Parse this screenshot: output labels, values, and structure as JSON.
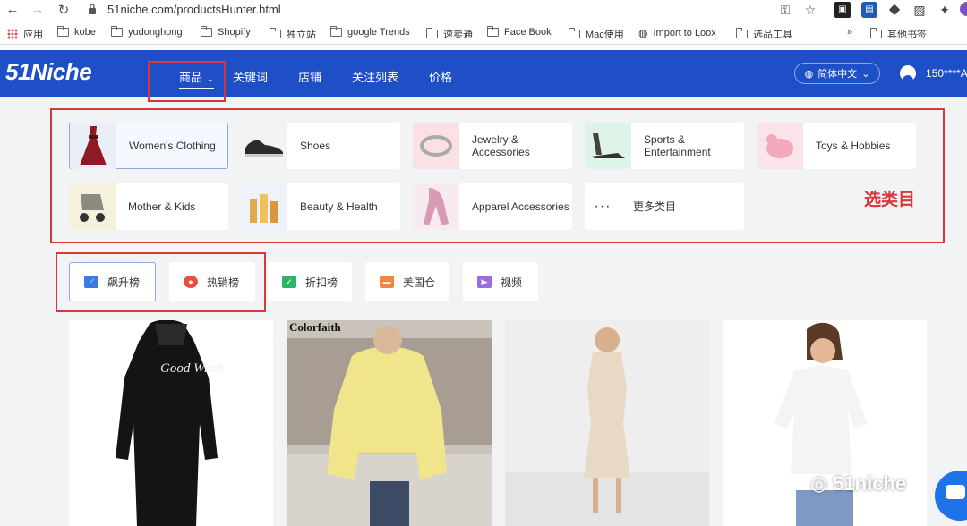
{
  "browser": {
    "url": "51niche.com/productsHunter.html",
    "bookmarks": [
      {
        "label": "应用",
        "icon": "apps-grid-icon"
      },
      {
        "label": "kobe",
        "icon": "folder-icon"
      },
      {
        "label": "yudonghong",
        "icon": "folder-icon"
      },
      {
        "label": "Shopify",
        "icon": "folder-icon"
      },
      {
        "label": "独立站",
        "icon": "folder-icon"
      },
      {
        "label": "google Trends",
        "icon": "folder-icon"
      },
      {
        "label": "速卖通",
        "icon": "folder-icon"
      },
      {
        "label": "Face Book",
        "icon": "folder-icon"
      },
      {
        "label": "Mac使用",
        "icon": "folder-icon"
      },
      {
        "label": "Import to Loox",
        "icon": "globe-icon"
      },
      {
        "label": "选品工具",
        "icon": "folder-icon"
      }
    ],
    "bookmarks_overflow": "»",
    "other_bookmarks": "其他书签"
  },
  "site": {
    "logo": "51Niche",
    "nav": [
      {
        "label": "商品"
      },
      {
        "label": "关键词"
      },
      {
        "label": "店铺"
      },
      {
        "label": "关注列表"
      },
      {
        "label": "价格"
      }
    ],
    "language": "简体中文",
    "user": "150****A"
  },
  "categories": [
    {
      "label": "Women's Clothing",
      "selected": true,
      "thumb_color": "#e9eef7",
      "icon": "dress-icon"
    },
    {
      "label": "Shoes",
      "selected": false,
      "thumb_color": "#f3f3f3",
      "icon": "shoe-icon"
    },
    {
      "label": "Jewelry & Accessories",
      "selected": false,
      "thumb_color": "#fbe1e6",
      "icon": "bracelet-icon"
    },
    {
      "label": "Sports & Entertainment",
      "selected": false,
      "thumb_color": "#dff4e8",
      "icon": "treadmill-icon"
    },
    {
      "label": "Toys & Hobbies",
      "selected": false,
      "thumb_color": "#fbe3ea",
      "icon": "toy-icon"
    },
    {
      "label": "Mother & Kids",
      "selected": false,
      "thumb_color": "#f6f1dc",
      "icon": "stroller-icon"
    },
    {
      "label": "Beauty & Health",
      "selected": false,
      "thumb_color": "#eef3fb",
      "icon": "cosmetics-icon"
    },
    {
      "label": "Apparel Accessories",
      "selected": false,
      "thumb_color": "#f7eaf0",
      "icon": "scarf-icon"
    },
    {
      "label": "更多类目",
      "selected": false,
      "thumb_color": "#ffffff",
      "icon": "more-dots-icon"
    }
  ],
  "annotation": "选类目",
  "rank_tabs": [
    {
      "label": "飙升榜",
      "selected": true,
      "color": "#3b7be8",
      "icon": "trend-chart-icon"
    },
    {
      "label": "热销榜",
      "selected": false,
      "color": "#e8503b",
      "icon": "hot-icon"
    },
    {
      "label": "折扣榜",
      "selected": false,
      "color": "#2cb564",
      "icon": "discount-icon"
    },
    {
      "label": "美国仓",
      "selected": false,
      "color": "#f0873a",
      "icon": "truck-icon"
    },
    {
      "label": "视频",
      "selected": false,
      "color": "#9b6be0",
      "icon": "video-icon"
    }
  ],
  "products": [
    {
      "image_text": "Good Witch",
      "icon": "product-black-hoodie-dress-image"
    },
    {
      "image_text": "Colorfaith",
      "icon": "product-yellow-sweater-image"
    },
    {
      "image_text": "",
      "icon": "product-beige-knit-dress-image"
    },
    {
      "image_text": "",
      "icon": "product-white-tshirt-image"
    }
  ],
  "watermark": "51niche",
  "colors": {
    "brand_blue": "#1e4fc6",
    "annotation_red": "#d9383a"
  }
}
